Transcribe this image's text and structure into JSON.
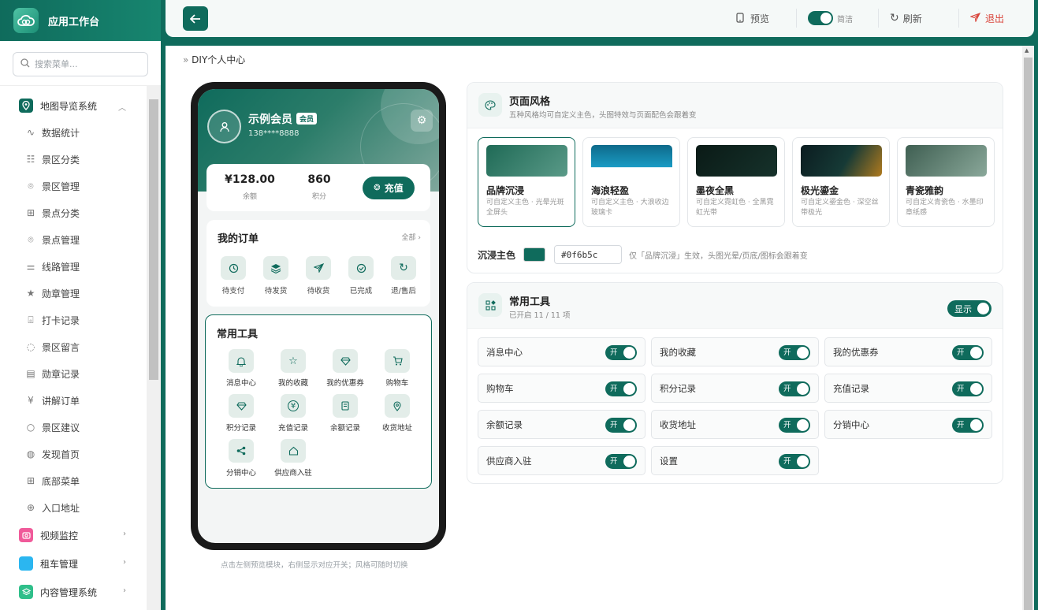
{
  "sidebar": {
    "app_title": "应用工作台",
    "search_placeholder": "搜索菜单...",
    "group1": "地图导览系统",
    "sub_items": [
      "数据统计",
      "景区分类",
      "景区管理",
      "景点分类",
      "景点管理",
      "线路管理",
      "勋章管理",
      "打卡记录",
      "景区留言",
      "勋章记录",
      "讲解订单",
      "景区建议",
      "发现首页",
      "底部菜单",
      "入口地址"
    ],
    "groups": [
      {
        "label": "视频监控",
        "color": "#f05a9a"
      },
      {
        "label": "租车管理",
        "color": "#2bb6f0"
      },
      {
        "label": "内容管理系统",
        "color": "#2fbf8a"
      }
    ]
  },
  "topbar": {
    "preview": "预览",
    "simple": "简洁",
    "refresh": "刷新",
    "logout": "退出"
  },
  "breadcrumb": "DIY个人中心",
  "phone": {
    "user_name": "示例会员",
    "member_badge": "会员",
    "user_phone": "138****8888",
    "balance_value": "¥128.00",
    "balance_label": "余额",
    "points_value": "860",
    "points_label": "积分",
    "recharge": "充值",
    "orders_title": "我的订单",
    "orders_all": "全部 ›",
    "orders": [
      "待支付",
      "待发货",
      "待收货",
      "已完成",
      "退/售后"
    ],
    "tools_title": "常用工具",
    "tools": [
      "消息中心",
      "我的收藏",
      "我的优惠券",
      "购物车",
      "积分记录",
      "充值记录",
      "余额记录",
      "收货地址",
      "分销中心",
      "供应商入驻"
    ],
    "hint": "点击左侧预览模块，右侧显示对应开关；风格可随时切换"
  },
  "style_panel": {
    "title": "页面风格",
    "subtitle": "五种风格均可自定义主色，头图特效与页面配色会跟着变",
    "themes": [
      {
        "name": "品牌沉浸",
        "desc": "可自定义主色 · 光晕光斑全屏头",
        "selected": true
      },
      {
        "name": "海浪轻盈",
        "desc": "可自定义主色 · 大浪收边玻璃卡",
        "selected": false
      },
      {
        "name": "墨夜全黑",
        "desc": "可自定义霓虹色 · 全黑霓虹光带",
        "selected": false
      },
      {
        "name": "极光鎏金",
        "desc": "可自定义鎏金色 · 深空丝带极光",
        "selected": false
      },
      {
        "name": "青瓷雅韵",
        "desc": "可自定义青瓷色 · 水墨印章纸感",
        "selected": false
      }
    ],
    "color_label": "沉浸主色",
    "color_hex": "#0f6b5c",
    "color_note": "仅「品牌沉浸」生效，头图光晕/页底/图标会跟着变"
  },
  "tools_panel": {
    "title": "常用工具",
    "subtitle": "已开启 11 / 11 项",
    "show_label": "显示",
    "on_label": "开",
    "items": [
      "消息中心",
      "我的收藏",
      "我的优惠券",
      "购物车",
      "积分记录",
      "充值记录",
      "余额记录",
      "收货地址",
      "分销中心",
      "供应商入驻",
      "设置"
    ]
  },
  "colors": {
    "brand": "#0f6b5c",
    "logout": "#d9443a"
  }
}
